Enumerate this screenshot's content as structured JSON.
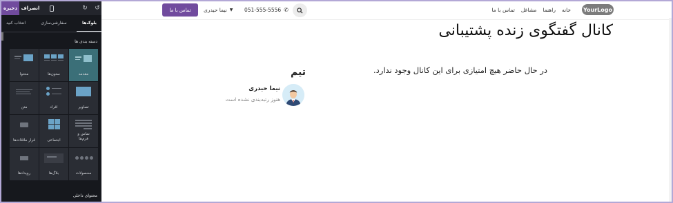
{
  "editor": {
    "save_label": "ذخیره",
    "discard_label": "انصراف",
    "tabs": [
      {
        "label": "بلوک‌ها",
        "active": true
      },
      {
        "label": "سفارشی‌سازی",
        "active": false
      },
      {
        "label": "انتخاب کنید",
        "active": false
      }
    ],
    "category_heading": "دسته بندی ها",
    "blocks": [
      {
        "label": "مقدمه",
        "selected": true
      },
      {
        "label": "ستون‌ها",
        "selected": false
      },
      {
        "label": "محتوا",
        "selected": false
      },
      {
        "label": "تصاویر",
        "selected": false
      },
      {
        "label": "افراد",
        "selected": false
      },
      {
        "label": "متن",
        "selected": false
      },
      {
        "label": "تماس و فرم‌ها",
        "selected": false
      },
      {
        "label": "اجتماعی",
        "selected": false
      },
      {
        "label": "قرار ملاقات‌ها",
        "selected": false
      },
      {
        "label": "محصولات",
        "selected": false
      },
      {
        "label": "بلاگ‌ها",
        "selected": false
      },
      {
        "label": "رویدادها",
        "selected": false
      }
    ],
    "inner_content_heading": "محتوای داخلی",
    "accent_color": "#714b9e"
  },
  "header": {
    "logo_text": "YourLogo",
    "nav": [
      "خانه",
      "راهنما",
      "مشاغل",
      "تماس با ما"
    ],
    "phone": "051-555-5556",
    "user_name": "نیما حیدری",
    "cta_label": "تماس با ما"
  },
  "main": {
    "page_title": "کانال گفتگوی زنده پشتیبانی",
    "empty_message": "در حال حاضر هیچ امتیازی برای این کانال وجود ندارد.",
    "team_title": "تیم",
    "member": {
      "name": "نیما حیدری",
      "subtitle": "هنوز رتبه‌بندی نشده است"
    }
  }
}
